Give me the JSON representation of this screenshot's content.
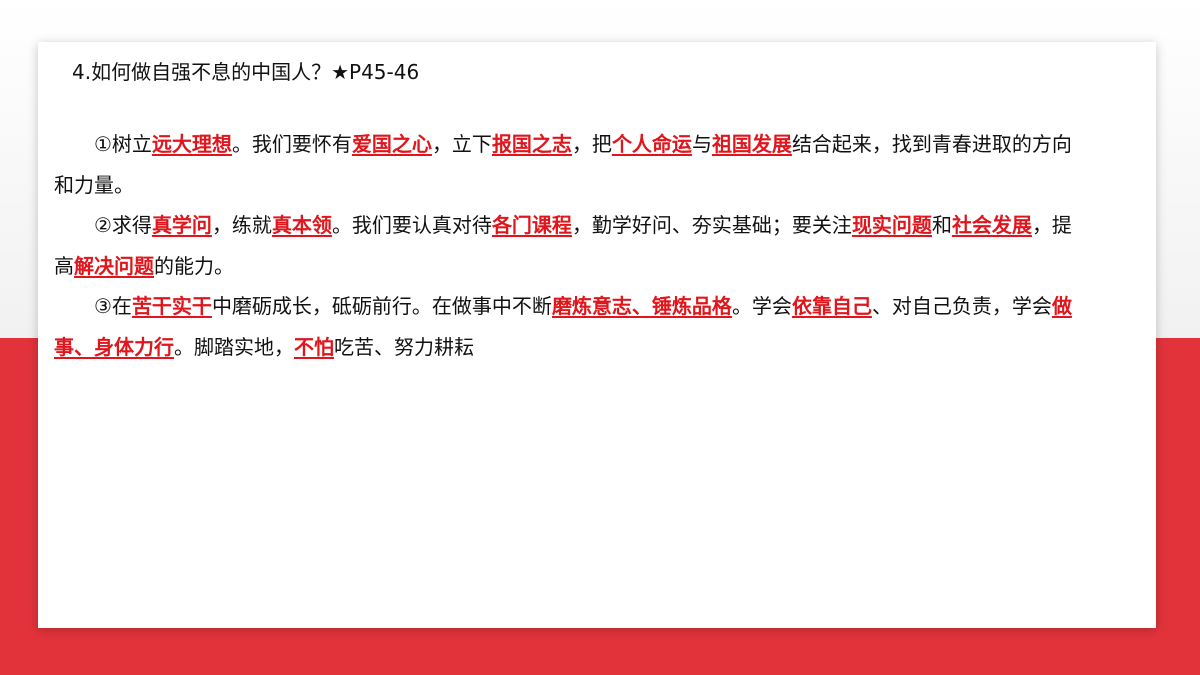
{
  "slide": {
    "heading": "4.如何做自强不息的中国人？★P45-46",
    "paragraphs": [
      [
        {
          "t": "①树立",
          "k": false
        },
        {
          "t": "远大理想",
          "k": true
        },
        {
          "t": "。我们要怀有",
          "k": false
        },
        {
          "t": "爱国之心",
          "k": true
        },
        {
          "t": "，立下",
          "k": false
        },
        {
          "t": "报国之志",
          "k": true
        },
        {
          "t": "，把",
          "k": false
        },
        {
          "t": "个人命运",
          "k": true
        },
        {
          "t": "与",
          "k": false
        },
        {
          "t": "祖国发展",
          "k": true
        },
        {
          "t": "结合起来，找到青春进取的方向和力量。",
          "k": false
        }
      ],
      [
        {
          "t": "②求得",
          "k": false
        },
        {
          "t": "真学问",
          "k": true
        },
        {
          "t": "，练就",
          "k": false
        },
        {
          "t": "真本领",
          "k": true
        },
        {
          "t": "。我们要认真对待",
          "k": false
        },
        {
          "t": "各门课程",
          "k": true
        },
        {
          "t": "，勤学好问、夯实基础；要关注",
          "k": false
        },
        {
          "t": "现实问题",
          "k": true
        },
        {
          "t": "和",
          "k": false
        },
        {
          "t": "社会发展",
          "k": true
        },
        {
          "t": "，提高",
          "k": false
        },
        {
          "t": "解决问题",
          "k": true
        },
        {
          "t": "的能力。",
          "k": false
        }
      ],
      [
        {
          "t": "③在",
          "k": false
        },
        {
          "t": "苦干实干",
          "k": true
        },
        {
          "t": "中磨砺成长，砥砺前行。在做事中不断",
          "k": false
        },
        {
          "t": "磨炼意志、锤炼品格",
          "k": true
        },
        {
          "t": "。学会",
          "k": false
        },
        {
          "t": "依靠自己",
          "k": true
        },
        {
          "t": "、对自己负责，学会",
          "k": false
        },
        {
          "t": "做事、身体力行",
          "k": true
        },
        {
          "t": "。脚踏实地，",
          "k": false
        },
        {
          "t": "不怕",
          "k": true
        },
        {
          "t": "吃苦、努力耕耘",
          "k": false
        }
      ]
    ]
  },
  "colors": {
    "accent_red": "#e0161c",
    "band_red": "#e2333b"
  }
}
